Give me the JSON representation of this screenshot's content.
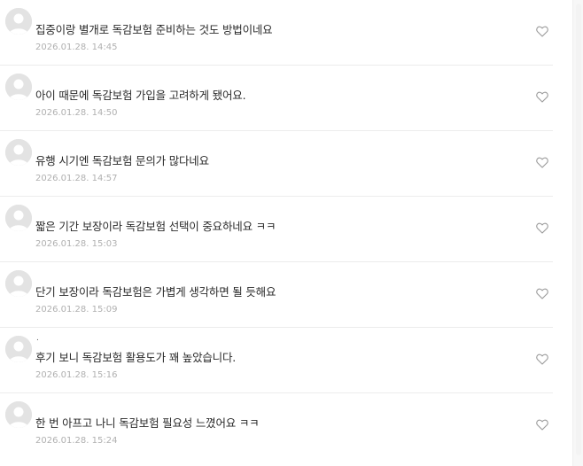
{
  "comments": [
    {
      "text": "집중이랑 별개로 독감보험 준비하는 것도 방법이네요",
      "date": "2026.01.28. 14:45",
      "marker": ""
    },
    {
      "text": "아이 때문에 독감보험 가입을 고려하게 됐어요.",
      "date": "2026.01.28. 14:50",
      "marker": ""
    },
    {
      "text": "유행 시기엔 독감보험 문의가 많다네요",
      "date": "2026.01.28. 14:57",
      "marker": ""
    },
    {
      "text": "짧은 기간 보장이라 독감보험 선택이 중요하네요 ㅋㅋ",
      "date": "2026.01.28. 15:03",
      "marker": ""
    },
    {
      "text": "단기 보장이라 독감보험은 가볍게 생각하면 될 듯해요",
      "date": "2026.01.28. 15:09",
      "marker": ""
    },
    {
      "text": "후기 보니 독감보험 활용도가 꽤 높았습니다.",
      "date": "2026.01.28. 15:16",
      "marker": "."
    },
    {
      "text": "한 번 아프고 나니 독감보험 필요성 느꼈어요 ㅋㅋ",
      "date": "2026.01.28. 15:24",
      "marker": ""
    }
  ],
  "icons": {
    "avatar": "default-profile-icon",
    "like": "heart-outline-icon"
  },
  "colors": {
    "date": "#b0b0b0",
    "divider": "#ececec",
    "avatar_bg": "#e3e3e3",
    "avatar_fg": "#ffffff",
    "heart": "#9a9a9a"
  }
}
